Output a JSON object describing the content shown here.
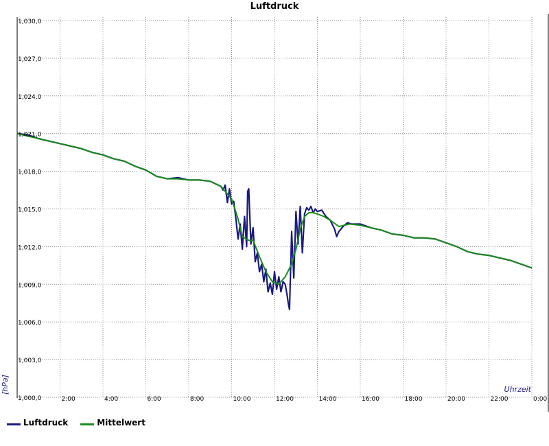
{
  "chart_data": {
    "type": "line",
    "title": "Luftdruck",
    "xlabel": "Uhrzeit",
    "ylabel": "[hPa]",
    "xlim": [
      0,
      24
    ],
    "ylim": [
      1000,
      1030
    ],
    "x_ticks": [
      {
        "value": 2,
        "label": "2:00"
      },
      {
        "value": 4,
        "label": "4:00"
      },
      {
        "value": 6,
        "label": "6:00"
      },
      {
        "value": 8,
        "label": "8:00"
      },
      {
        "value": 10,
        "label": "10:00"
      },
      {
        "value": 12,
        "label": "12:00"
      },
      {
        "value": 14,
        "label": "14:00"
      },
      {
        "value": 16,
        "label": "16:00"
      },
      {
        "value": 18,
        "label": "18:00"
      },
      {
        "value": 20,
        "label": "20:00"
      },
      {
        "value": 22,
        "label": "22:00"
      },
      {
        "value": 24,
        "label": "0:00"
      }
    ],
    "y_ticks": [
      {
        "value": 1000,
        "label": "1,000,0"
      },
      {
        "value": 1003,
        "label": "1,003,0"
      },
      {
        "value": 1006,
        "label": "1,006,0"
      },
      {
        "value": 1009,
        "label": "1,009,0"
      },
      {
        "value": 1012,
        "label": "1,012,0"
      },
      {
        "value": 1015,
        "label": "1,015,0"
      },
      {
        "value": 1018,
        "label": "1,018,0"
      },
      {
        "value": 1021,
        "label": "1,021,0"
      },
      {
        "value": 1024,
        "label": "1,024,0"
      },
      {
        "value": 1027,
        "label": "1,027,0"
      },
      {
        "value": 1030,
        "label": "1,030,0"
      }
    ],
    "grid": true,
    "legend_position": "bottom-left",
    "series": [
      {
        "name": "Luftdruck",
        "color": "#1a1a80",
        "x": [
          0,
          0.5,
          1,
          1.5,
          2,
          2.5,
          3,
          3.5,
          4,
          4.5,
          5,
          5.5,
          6,
          6.5,
          7,
          7.5,
          8,
          8.5,
          9,
          9.5,
          9.6,
          9.7,
          9.8,
          9.9,
          10.0,
          10.1,
          10.2,
          10.3,
          10.4,
          10.5,
          10.6,
          10.7,
          10.75,
          10.8,
          10.9,
          11.0,
          11.1,
          11.2,
          11.3,
          11.4,
          11.5,
          11.6,
          11.7,
          11.8,
          11.9,
          12.0,
          12.1,
          12.2,
          12.3,
          12.4,
          12.5,
          12.6,
          12.65,
          12.7,
          12.8,
          12.9,
          13.0,
          13.1,
          13.2,
          13.3,
          13.4,
          13.5,
          13.6,
          13.7,
          13.8,
          13.9,
          14.0,
          14.2,
          14.4,
          14.6,
          14.8,
          14.9,
          15.0,
          15.2,
          15.4,
          15.6,
          15.8,
          16,
          16.5,
          17,
          17.5,
          18,
          18.5,
          19,
          19.5,
          20,
          20.5,
          21,
          21.5,
          22,
          22.5,
          23,
          23.5,
          24
        ],
        "values": [
          1021.0,
          1020.9,
          1020.6,
          1020.4,
          1020.2,
          1020.0,
          1019.8,
          1019.5,
          1019.3,
          1019.0,
          1018.8,
          1018.4,
          1018.1,
          1017.6,
          1017.4,
          1017.5,
          1017.3,
          1017.3,
          1017.2,
          1016.8,
          1016.5,
          1016.9,
          1015.5,
          1016.6,
          1015.4,
          1015.6,
          1014.2,
          1012.6,
          1013.8,
          1011.8,
          1014.4,
          1012.0,
          1016.4,
          1016.6,
          1012.2,
          1013.5,
          1010.8,
          1011.5,
          1010.0,
          1010.6,
          1009.2,
          1010.2,
          1008.4,
          1009.1,
          1008.2,
          1010.0,
          1008.6,
          1009.6,
          1008.4,
          1009.2,
          1009.0,
          1008.0,
          1007.4,
          1007.0,
          1013.2,
          1009.5,
          1014.8,
          1012.2,
          1015.2,
          1011.5,
          1014.6,
          1015.1,
          1014.9,
          1015.2,
          1014.7,
          1015.0,
          1014.8,
          1014.9,
          1014.4,
          1014.1,
          1013.4,
          1012.8,
          1013.2,
          1013.6,
          1013.9,
          1013.8,
          1013.8,
          1013.8,
          1013.5,
          1013.3,
          1013.0,
          1012.9,
          1012.7,
          1012.7,
          1012.6,
          1012.3,
          1012.0,
          1011.6,
          1011.4,
          1011.3,
          1011.1,
          1010.9,
          1010.6,
          1010.3
        ]
      },
      {
        "name": "Mittelwert",
        "color": "#1a8c1a",
        "x": [
          0,
          0.5,
          1,
          1.5,
          2,
          2.5,
          3,
          3.5,
          4,
          4.5,
          5,
          5.5,
          6,
          6.5,
          7,
          7.5,
          8,
          8.5,
          9,
          9.5,
          10.0,
          10.3,
          10.5,
          10.8,
          11.0,
          11.3,
          11.6,
          11.9,
          12.2,
          12.5,
          12.8,
          13.0,
          13.2,
          13.4,
          13.6,
          13.8,
          14.0,
          14.3,
          14.6,
          15.0,
          15.5,
          16,
          16.5,
          17,
          17.5,
          18,
          18.5,
          19,
          19.5,
          20,
          20.5,
          21,
          21.5,
          22,
          22.5,
          23,
          23.5,
          24
        ],
        "values": [
          1021.0,
          1020.8,
          1020.6,
          1020.4,
          1020.2,
          1020.0,
          1019.8,
          1019.5,
          1019.3,
          1019.0,
          1018.8,
          1018.4,
          1018.1,
          1017.6,
          1017.4,
          1017.4,
          1017.3,
          1017.3,
          1017.2,
          1016.8,
          1015.8,
          1014.2,
          1012.8,
          1012.5,
          1012.5,
          1011.2,
          1010.0,
          1009.2,
          1009.0,
          1009.6,
          1010.6,
          1011.8,
          1013.4,
          1014.4,
          1014.7,
          1014.7,
          1014.6,
          1014.4,
          1014.1,
          1013.6,
          1013.8,
          1013.7,
          1013.5,
          1013.3,
          1013.0,
          1012.9,
          1012.7,
          1012.7,
          1012.6,
          1012.3,
          1012.0,
          1011.6,
          1011.4,
          1011.3,
          1011.1,
          1010.9,
          1010.6,
          1010.3
        ]
      }
    ]
  }
}
